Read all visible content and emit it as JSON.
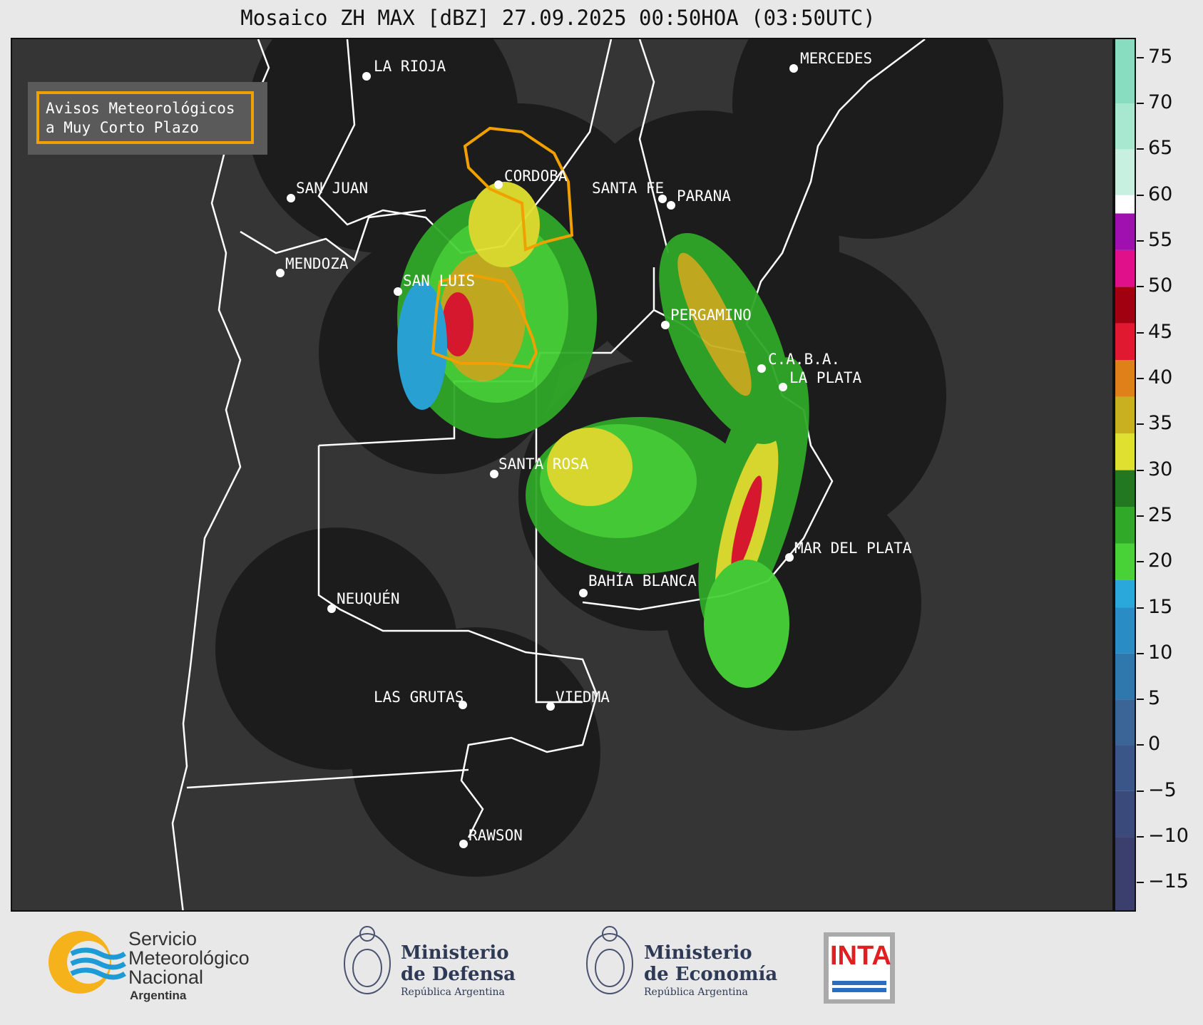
{
  "title": "Mosaico ZH MAX [dBZ] 27.09.2025 00:50HOA (03:50UTC)",
  "warning_box": {
    "line1": "Avisos Meteorológicos",
    "line2": "a Muy Corto Plazo",
    "border_color": "#f0a000"
  },
  "cities": {
    "la_rioja": "LA RIOJA",
    "mercedes": "MERCEDES",
    "cordoba": "CORDOBA",
    "san_juan": "SAN JUAN",
    "santa_fe": "SANTA FE",
    "parana": "PARANA",
    "mendoza": "MENDOZA",
    "san_luis": "SAN LUIS",
    "pergamino": "PERGAMINO",
    "caba": "C.A.B.A.",
    "la_plata": "LA PLATA",
    "santa_rosa": "SANTA ROSA",
    "mar_del_plata": "MAR DEL PLATA",
    "bahia_blanca": "BAHÍA BLANCA",
    "neuquen": "NEUQUÉN",
    "las_grutas": "LAS GRUTAS",
    "viedma": "VIEDMA",
    "rawson": "RAWSON"
  },
  "colorbar": {
    "unit": "dBZ",
    "range": [
      -18,
      77
    ],
    "tick_labels": [
      "75",
      "70",
      "65",
      "60",
      "55",
      "50",
      "45",
      "40",
      "35",
      "30",
      "25",
      "20",
      "15",
      "10",
      "5",
      "0",
      "−5",
      "−10",
      "−15"
    ],
    "tick_values": [
      75,
      70,
      65,
      60,
      55,
      50,
      45,
      40,
      35,
      30,
      25,
      20,
      15,
      10,
      5,
      0,
      -5,
      -10,
      -15
    ],
    "colors": [
      {
        "from": -18,
        "to": -10,
        "color": "#3b3f6e"
      },
      {
        "from": -10,
        "to": -5,
        "color": "#3a4a7a"
      },
      {
        "from": -5,
        "to": 0,
        "color": "#3a5587"
      },
      {
        "from": 0,
        "to": 5,
        "color": "#3a6596"
      },
      {
        "from": 5,
        "to": 10,
        "color": "#2f78ad"
      },
      {
        "from": 10,
        "to": 15,
        "color": "#2a8cc4"
      },
      {
        "from": 15,
        "to": 18,
        "color": "#2aa8dc"
      },
      {
        "from": 18,
        "to": 22,
        "color": "#48d238"
      },
      {
        "from": 22,
        "to": 26,
        "color": "#30a828"
      },
      {
        "from": 26,
        "to": 30,
        "color": "#227820"
      },
      {
        "from": 30,
        "to": 34,
        "color": "#e0e030"
      },
      {
        "from": 34,
        "to": 38,
        "color": "#c8b020"
      },
      {
        "from": 38,
        "to": 42,
        "color": "#e08018"
      },
      {
        "from": 42,
        "to": 46,
        "color": "#e01830"
      },
      {
        "from": 46,
        "to": 50,
        "color": "#a00010"
      },
      {
        "from": 50,
        "to": 54,
        "color": "#e0108a"
      },
      {
        "from": 54,
        "to": 58,
        "color": "#a010b0"
      },
      {
        "from": 58,
        "to": 60,
        "color": "#ffffff"
      },
      {
        "from": 60,
        "to": 65,
        "color": "#c8f0e0"
      },
      {
        "from": 65,
        "to": 70,
        "color": "#a8e8d0"
      },
      {
        "from": 70,
        "to": 77,
        "color": "#88dcc0"
      }
    ]
  },
  "logos": {
    "smn_line1": "Servicio",
    "smn_line2": "Meteorológico",
    "smn_line3": "Nacional",
    "smn_line4": "Argentina",
    "defensa_line1": "Ministerio",
    "defensa_line2": "de Defensa",
    "defensa_line3": "República Argentina",
    "economia_line1": "Ministerio",
    "economia_line2": "de Economía",
    "economia_line3": "República Argentina",
    "inta": "INTA"
  }
}
